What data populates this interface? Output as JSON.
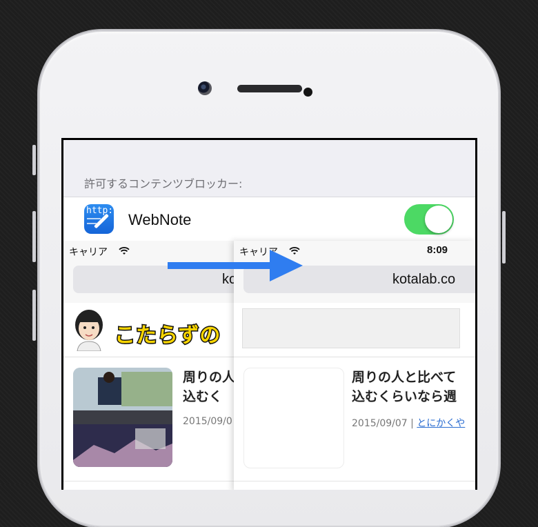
{
  "settings": {
    "section_label": "許可するコンテンツブロッカー:",
    "app_name": "WebNote",
    "app_icon_text": "http:",
    "toggle_on": true
  },
  "browser_left": {
    "carrier": "キャリア",
    "url_fragment": "ko",
    "logo_text": "こたらずの",
    "article_title_line1": "周りの人",
    "article_title_line2": "込むく",
    "article_date": "2015/09/0"
  },
  "browser_right": {
    "carrier": "キャリア",
    "time": "8:09",
    "url": "kotalab.co",
    "article_title_line1": "周りの人と比べて",
    "article_title_line2": "込むくらいなら週",
    "article_date": "2015/09/07 | ",
    "article_category": "とにかくや"
  },
  "colors": {
    "toggle_on": "#4cd964",
    "arrow": "#2f7df0",
    "link": "#2a6cd0"
  }
}
